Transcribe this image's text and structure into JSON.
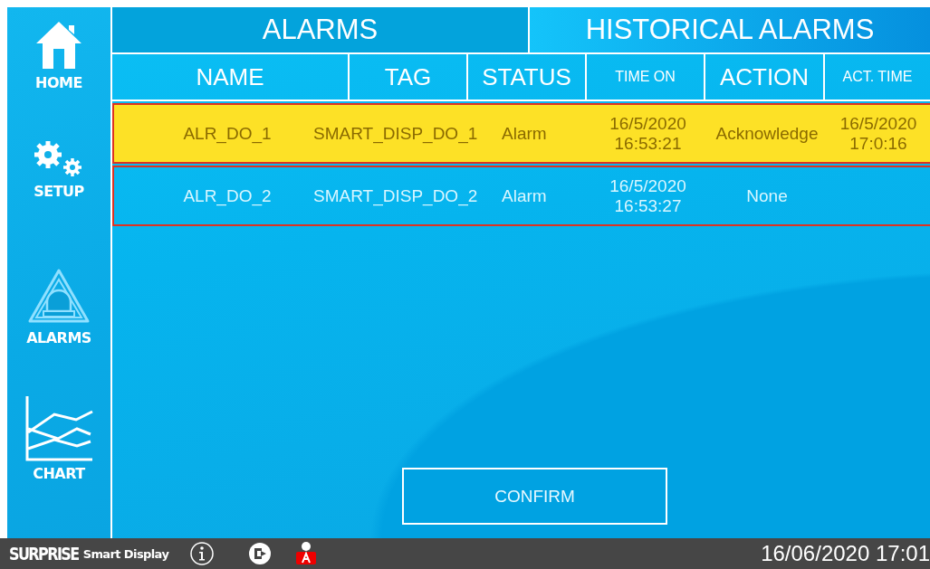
{
  "sidebar": {
    "items": [
      {
        "label": "HOME",
        "kind": "home"
      },
      {
        "label": "SETUP",
        "kind": "setup"
      },
      {
        "label": "ALARMS",
        "kind": "alarms"
      },
      {
        "label": "CHART",
        "kind": "chart"
      }
    ]
  },
  "tabs": [
    {
      "label": "ALARMS",
      "selected": true
    },
    {
      "label": "HISTORICAL ALARMS",
      "selected": false
    }
  ],
  "table": {
    "columns": [
      {
        "label": "NAME",
        "kind": "large"
      },
      {
        "label": "TAG",
        "kind": "large"
      },
      {
        "label": "STATUS",
        "kind": "large"
      },
      {
        "label": "TIME ON",
        "kind": "small"
      },
      {
        "label": "ACTION",
        "kind": "large"
      },
      {
        "label": "ACT. TIME",
        "kind": "small"
      }
    ],
    "rows": [
      {
        "acknowledged": true,
        "cells": [
          "ALR_DO_1",
          "SMART_DISP_DO_1",
          "Alarm",
          "16/5/2020\n16:53:21",
          "Acknowledge",
          "16/5/2020\n17:0:16"
        ]
      },
      {
        "acknowledged": false,
        "cells": [
          "ALR_DO_2",
          "SMART_DISP_DO_2",
          "Alarm",
          "16/5/2020\n16:53:27",
          "None"
        ]
      }
    ]
  },
  "confirm_button": "CONFIRM",
  "status_bar": {
    "brand": "SURPRISE",
    "product": "Smart Display",
    "datetime": "16/06/2020 17:01"
  }
}
